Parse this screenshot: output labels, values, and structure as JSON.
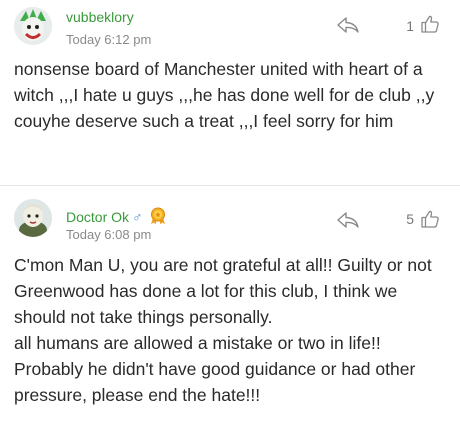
{
  "comments": [
    {
      "username": "vubbeklory",
      "time": "Today 6:12 pm",
      "likes": "1",
      "text": "nonsense board of Manchester united with heart of a witch ,,,I hate u guys ,,,he has done well for de club ,,y couyhe deserve such a treat ,,,I feel sorry for him",
      "icons": {
        "reply": "reply-arrow-icon",
        "like": "thumbs-up-icon"
      }
    },
    {
      "username": "Doctor Ok",
      "gender_symbol": "♂",
      "time": "Today 6:08 pm",
      "likes": "5",
      "text": "C'mon Man U, you are not grateful at all!! Guilty or not Greenwood has done a lot for this club, I think we should not take things personally.\nall humans are allowed a mistake or two in life!! Probably he didn't have good guidance or had other pressure, please end the hate!!!",
      "icons": {
        "badge": "medal-badge-icon",
        "reply": "reply-arrow-icon",
        "like": "thumbs-up-icon"
      }
    }
  ],
  "colors": {
    "username": "#3a9a3a",
    "gender": "#4a90d9",
    "meta": "#8a8a8a",
    "badge": "#f0a020"
  }
}
